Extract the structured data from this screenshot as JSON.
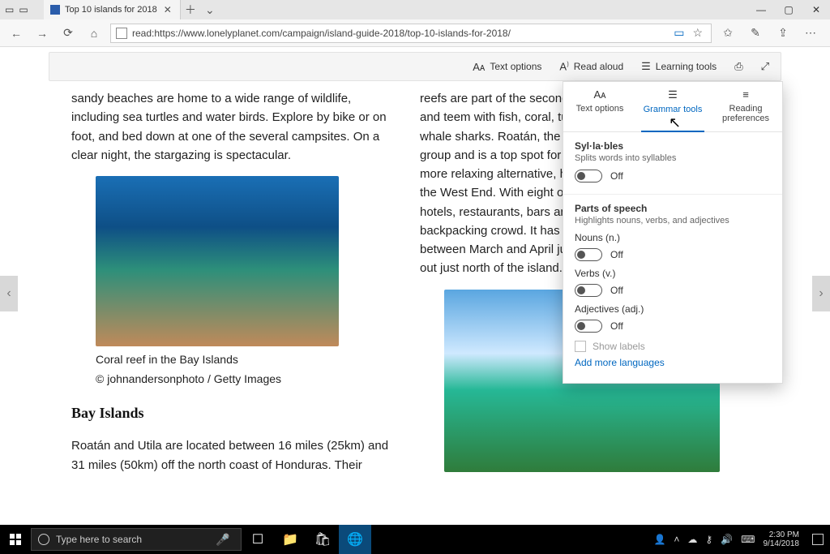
{
  "titlebar": {
    "tab_title": "Top 10 islands for 2018",
    "close_glyph": "✕",
    "newtab_glyph": "＋",
    "more_glyph": "⌄",
    "win": {
      "min": "—",
      "max": "▢",
      "close": "✕"
    }
  },
  "navbar": {
    "url": "read:https://www.lonelyplanet.com/campaign/island-guide-2018/top-10-islands-for-2018/",
    "icons": {
      "back": "←",
      "forward": "→",
      "refresh": "⟳",
      "home": "⌂",
      "readview": "▭",
      "star": "☆",
      "fav": "✩",
      "notes": "✎",
      "share": "⇪",
      "more": "⋯"
    }
  },
  "reading_toolbar": {
    "text_options": "Text options",
    "read_aloud": "Read aloud",
    "learning_tools": "Learning tools"
  },
  "article": {
    "left_para1": "sandy beaches are home to a wide range of wildlife, including sea turtles and water birds. Explore by bike or on foot, and bed down at one of the several campsites. On a clear night, the stargazing is spectacular.",
    "caption": "Coral reef in the Bay Islands",
    "credit": "© johnandersonphoto / Getty Images",
    "heading": "Bay Islands",
    "left_para2": "Roatán and Utila are located between 16 miles (25km) and 31 miles (50km) off the north coast of Honduras. Their",
    "right_para": "reefs are part of the second-largest barrier reef in the world, and teem with fish, coral, turtles, dolphins, rays and even whale sharks. Roatán, the largest, is the most popular of the group and is a top spot for diving and snorkeling. For a more relaxing alternative, head to the white-sand beach of the West End. With eight or so beaches and dozens of hotels, restaurants, bars and dive shops, Utila draws the backpacking crowd. It has fantastic diving spots, and between March and April juvenile whale sharks that hang out just north of the island."
  },
  "lt_panel": {
    "tabs": {
      "text_options": "Text options",
      "grammar_tools": "Grammar tools",
      "reading_prefs": "Reading preferences"
    },
    "syllables": {
      "title": "Syl·la·bles",
      "desc": "Splits words into syllables",
      "state": "Off"
    },
    "parts": {
      "title": "Parts of speech",
      "desc": "Highlights nouns, verbs, and adjectives",
      "nouns_label": "Nouns (n.)",
      "nouns_state": "Off",
      "verbs_label": "Verbs (v.)",
      "verbs_state": "Off",
      "adjectives_label": "Adjectives (adj.)",
      "adjectives_state": "Off",
      "show_labels": "Show labels",
      "add_more": "Add more languages"
    }
  },
  "taskbar": {
    "search_placeholder": "Type here to search",
    "time": "2:30 PM",
    "date": "9/14/2018"
  }
}
